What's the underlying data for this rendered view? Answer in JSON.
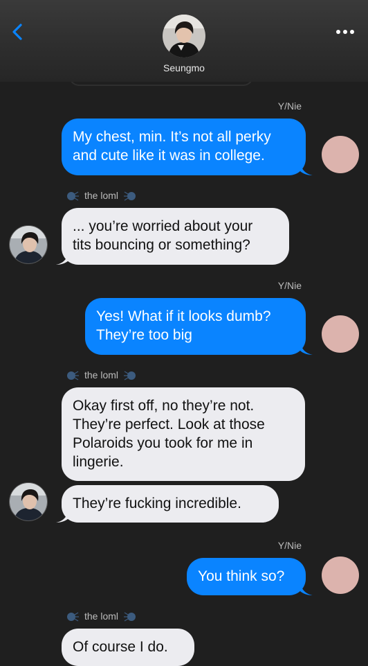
{
  "header": {
    "contact_name": "Seungmo"
  },
  "colors": {
    "sent_bubble": "#0a84ff",
    "received_bubble": "#ececf0",
    "background": "#1f1f1f",
    "accent": "#0a84ff"
  },
  "messages": [
    {
      "sender": "Y/Nie",
      "lines": [
        "My chest, min. It’s not all perky",
        "and cute like it was in college."
      ]
    },
    {
      "sender": "the loml",
      "lines": [
        "... you’re worried about your",
        "tits bouncing or something?"
      ]
    },
    {
      "sender": "Y/Nie",
      "lines": [
        "Yes! What if it looks dumb?",
        "They’re too big"
      ]
    },
    {
      "sender": "the loml",
      "lines": [
        "Okay first off, no they’re not.",
        "They’re perfect. Look at those",
        "Polaroids you took for me in",
        "lingerie."
      ]
    },
    {
      "sender": "the loml",
      "lines": [
        "They’re fucking incredible."
      ]
    },
    {
      "sender": "Y/Nie",
      "lines": [
        "You think so?"
      ]
    },
    {
      "sender": "the loml",
      "lines": [
        "Of course I do."
      ]
    }
  ]
}
